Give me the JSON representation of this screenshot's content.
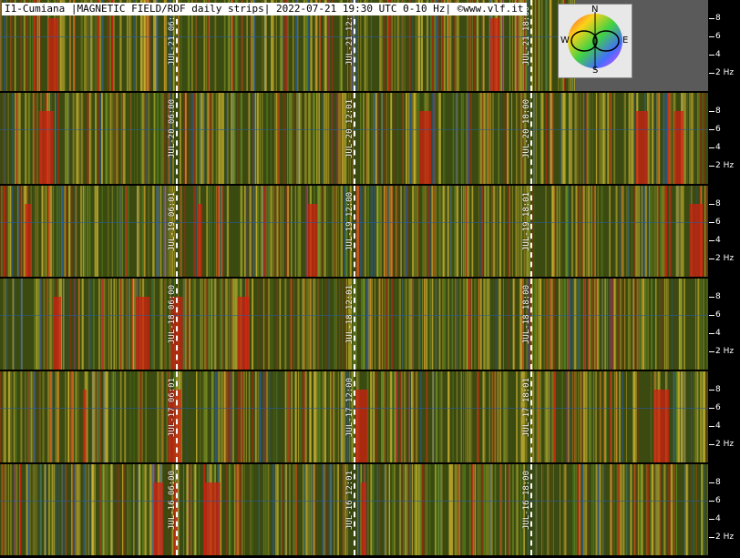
{
  "title": "I1-Cumiana |MAGNETIC FIELD/RDF daily strips| 2022-07-21 19:30 UTC 0-10 Hz| ©www.vlf.it",
  "compass": {
    "n": "N",
    "s": "S",
    "e": "E",
    "w": "W"
  },
  "chart_data": {
    "type": "heatmap",
    "title": "I1-Cumiana |MAGNETIC FIELD/RDF daily strips| 2022-07-21 19:30 UTC 0-10 Hz| ©www.vlf.it",
    "ylabel_unit": "Hz",
    "ylim": [
      0,
      10
    ],
    "y_ticks": [
      {
        "value": 8,
        "label": "8"
      },
      {
        "value": 6,
        "label": "6"
      },
      {
        "value": 4,
        "label": "4"
      },
      {
        "value": 2,
        "label": "2 Hz"
      }
    ],
    "x_time_range_hours": [
      0,
      24
    ],
    "strips": [
      {
        "day": "2022-07-21",
        "markers": [
          {
            "hour": 6,
            "label": "JUL-21 06:01"
          },
          {
            "hour": 12,
            "label": "JUL-21 12:00"
          },
          {
            "hour": 18,
            "label": "JUL-21 18:00"
          }
        ],
        "data_until_hour": 19.5
      },
      {
        "day": "2022-07-20",
        "markers": [
          {
            "hour": 6,
            "label": "JUL-20 06:00"
          },
          {
            "hour": 12,
            "label": "JUL-20 12:01"
          },
          {
            "hour": 18,
            "label": "JUL-20 18:00"
          }
        ]
      },
      {
        "day": "2022-07-19",
        "markers": [
          {
            "hour": 6,
            "label": "JUL-19 06:01"
          },
          {
            "hour": 12,
            "label": "JUL-19 12:00"
          },
          {
            "hour": 18,
            "label": "JUL-19 18:01"
          }
        ]
      },
      {
        "day": "2022-07-18",
        "markers": [
          {
            "hour": 6,
            "label": "JUL-18 06:00"
          },
          {
            "hour": 12,
            "label": "JUL-18 12:01"
          },
          {
            "hour": 18,
            "label": "JUL-18 18:00"
          }
        ]
      },
      {
        "day": "2022-07-17",
        "markers": [
          {
            "hour": 6,
            "label": "JUL-17 06:01"
          },
          {
            "hour": 12,
            "label": "JUL-17 12:00"
          },
          {
            "hour": 18,
            "label": "JUL-17 18:01"
          }
        ]
      },
      {
        "day": "2022-07-16",
        "markers": [
          {
            "hour": 6,
            "label": "JUL-16 06:00"
          },
          {
            "hour": 12,
            "label": "JUL-16 12:01"
          },
          {
            "hour": 18,
            "label": "JUL-16 18:00"
          }
        ]
      }
    ],
    "colors": {
      "base": "#3a4a10",
      "yellow": "#c8b030",
      "red": "#d02010",
      "blue": "#2a5aa0",
      "green": "#5a8a20"
    }
  }
}
